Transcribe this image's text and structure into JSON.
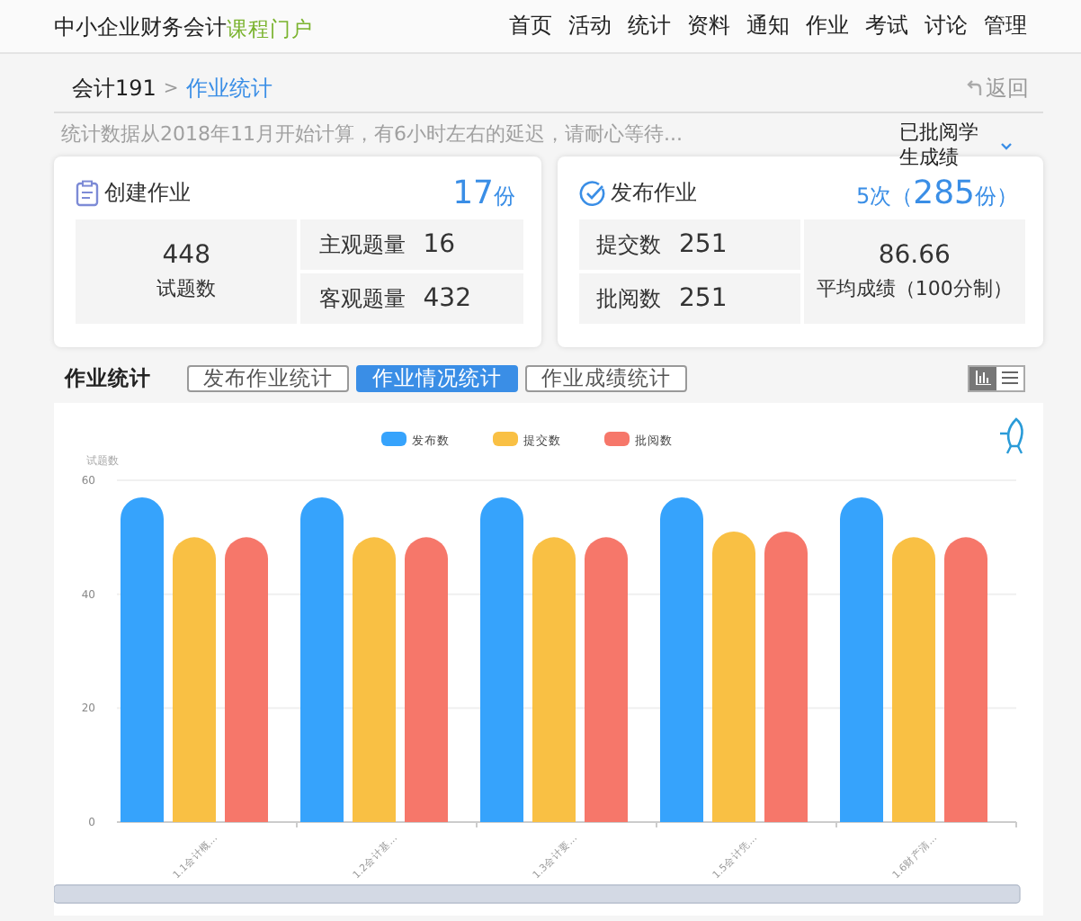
{
  "header": {
    "site_title": "中小企业财务会计",
    "portal_label": "课程门户",
    "nav": [
      {
        "label": "首页"
      },
      {
        "label": "活动"
      },
      {
        "label": "统计"
      },
      {
        "label": "资料"
      },
      {
        "label": "通知"
      },
      {
        "label": "作业"
      },
      {
        "label": "考试"
      },
      {
        "label": "讨论"
      },
      {
        "label": "管理"
      }
    ]
  },
  "breadcrumb": {
    "course": "会计191",
    "separator": ">",
    "current": "作业统计",
    "back": "返回"
  },
  "notice": "统计数据从2018年11月开始计算，有6小时左右的延迟，请耐心等待...",
  "grade_dropdown": "已批阅学生成绩",
  "created_card": {
    "title": "创建作业",
    "count": "17",
    "unit": "份",
    "total": "448",
    "total_label": "试题数",
    "rows": [
      {
        "label": "主观题量",
        "value": "16"
      },
      {
        "label": "客观题量",
        "value": "432"
      }
    ]
  },
  "published_card": {
    "title": "发布作业",
    "times": "5次（",
    "count": "285",
    "unit": "份）",
    "rows": [
      {
        "label": "提交数",
        "value": "251"
      },
      {
        "label": "批阅数",
        "value": "251"
      }
    ],
    "average": "86.66",
    "average_label": "平均成绩（100分制）"
  },
  "stats": {
    "title": "作业统计",
    "tabs": [
      {
        "label": "发布作业统计",
        "selected": false
      },
      {
        "label": "作业情况统计",
        "selected": true
      },
      {
        "label": "作业成绩统计",
        "selected": false
      }
    ],
    "views": [
      {
        "kind": "chart",
        "selected": true
      },
      {
        "kind": "list",
        "selected": false
      }
    ],
    "chart_data": {
      "type": "bar",
      "legend": "top",
      "ylabel": "试题数",
      "categories": [
        "1.1会计概...",
        "1.2会计基...",
        "1.3会计要...",
        "1.5会计凭...",
        "1.6财产清..."
      ],
      "series": [
        {
          "name": "发布数",
          "color": "#36a3fc",
          "values": [
            57,
            57,
            57,
            57,
            57
          ]
        },
        {
          "name": "提交数",
          "color": "#f9c044",
          "values": [
            50,
            50,
            50,
            51,
            50
          ]
        },
        {
          "name": "批阅数",
          "color": "#f6776a",
          "values": [
            50,
            50,
            50,
            51,
            50
          ]
        }
      ],
      "ylim": [
        0,
        60
      ],
      "yticks": [
        0,
        20,
        40,
        60
      ]
    }
  }
}
